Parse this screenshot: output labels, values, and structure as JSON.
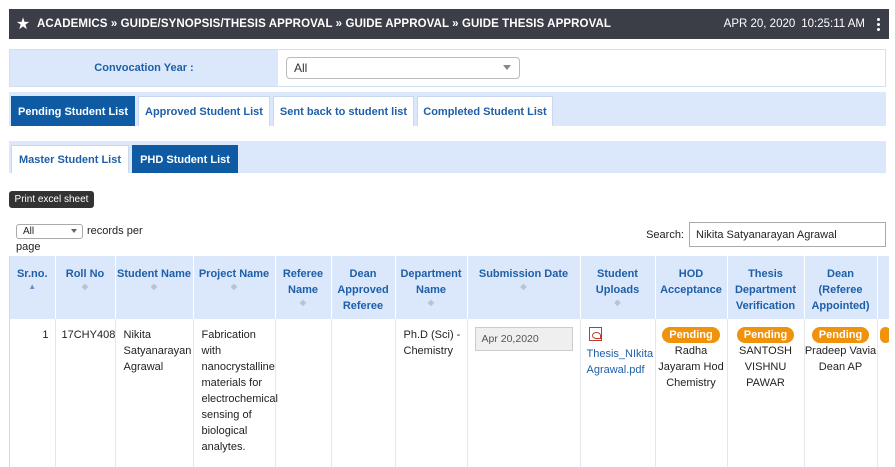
{
  "header": {
    "breadcrumb": "ACADEMICS » GUIDE/SYNOPSIS/THESIS APPROVAL » GUIDE APPROVAL » GUIDE THESIS APPROVAL",
    "date": "APR 20, 2020",
    "time": "10:25:11 AM"
  },
  "filter": {
    "label": "Convocation Year :",
    "selected": "All"
  },
  "tabs": [
    {
      "label": "Pending Student List"
    },
    {
      "label": "Approved Student List"
    },
    {
      "label": "Sent back to student list"
    },
    {
      "label": "Completed Student List"
    }
  ],
  "subtabs": [
    {
      "label": "Master Student List"
    },
    {
      "label": "PHD Student List"
    }
  ],
  "print_label": "Print excel sheet",
  "length": {
    "selected": "All",
    "text1": "records per",
    "text2": "page"
  },
  "search": {
    "label": "Search:",
    "value": "Nikita Satyanarayan Agrawal"
  },
  "columns": [
    "Sr.no.",
    "Roll No",
    "Student Name",
    "Project Name",
    "Referee Name",
    "Dean Approved Referee",
    "Department Name",
    "Submission Date",
    "Student Uploads",
    "HOD Acceptance",
    "Thesis Department Verification",
    "Dean (Referee Appointed)"
  ],
  "row": {
    "srno": "1",
    "roll": "17CHY408",
    "name": "Nikita Satyanarayan Agrawal",
    "project": "Fabrication with nanocrystalline materials for electrochemical sensing of biological analytes.",
    "referee": "",
    "dean_approved": "",
    "department": "Ph.D (Sci) - Chemistry",
    "submission_date": "Apr 20,2020",
    "upload_file": "Thesis_NIkita Agrawal.pdf",
    "hod_status": "Pending",
    "hod_name": "Radha Jayaram Hod Chemistry",
    "thesis_status": "Pending",
    "thesis_name": "SANTOSH VISHNU PAWAR",
    "dean_status": "Pending",
    "dean_name": "Pradeep Vavia Dean AP"
  },
  "colors": {
    "header_bg": "#3b3e47",
    "active_tab": "#0e5ba4",
    "accent": "#1e5fa8",
    "pending": "#f0920b"
  }
}
